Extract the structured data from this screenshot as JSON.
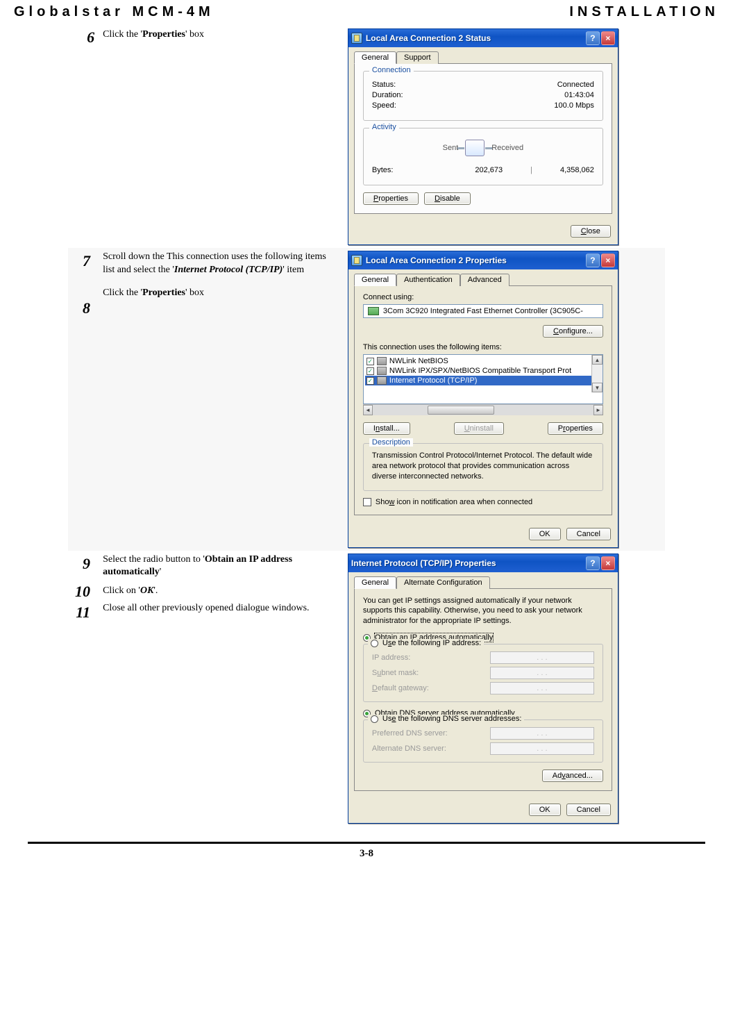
{
  "header": {
    "left": "Globalstar MCM-4M",
    "right": "INSTALLATION"
  },
  "pageNumber": "3-8",
  "steps": {
    "s6": {
      "num": "6",
      "pre": "Click the '",
      "bold": "Properties",
      "post": "' box"
    },
    "s7": {
      "num": "7",
      "pre": "Scroll down the  This connection uses the following items list and select the '",
      "bold": "Internet Protocol (TCP/IP)",
      "post": "' item"
    },
    "s8": {
      "num": "8",
      "pre": "Click the '",
      "bold": "Properties",
      "post": "' box"
    },
    "s9": {
      "num": "9",
      "pre": "Select the radio button to '",
      "bold": "Obtain an IP address automatically",
      "post": "'"
    },
    "s10": {
      "num": "10",
      "pre": "Click on '",
      "bold": "OK",
      "post": "'."
    },
    "s11": {
      "num": "11",
      "text": "Close all other previously opened dialogue windows."
    }
  },
  "win1": {
    "title": "Local Area Connection 2 Status",
    "tabs": {
      "general": "General",
      "support": "Support"
    },
    "groups": {
      "connection": "Connection",
      "activity": "Activity"
    },
    "connection": {
      "statusLabel": "Status:",
      "statusValue": "Connected",
      "durationLabel": "Duration:",
      "durationValue": "01:43:04",
      "speedLabel": "Speed:",
      "speedValue": "100.0 Mbps"
    },
    "activity": {
      "sent": "Sent",
      "received": "Received",
      "bytesLabel": "Bytes:",
      "sentVal": "202,673",
      "recvVal": "4,358,062"
    },
    "buttons": {
      "properties": "Properties",
      "disable": "Disable",
      "close": "Close"
    }
  },
  "win2": {
    "title": "Local Area Connection 2 Properties",
    "tabs": {
      "general": "General",
      "auth": "Authentication",
      "adv": "Advanced"
    },
    "connectUsing": "Connect using:",
    "adapter": "3Com 3C920 Integrated Fast Ethernet Controller (3C905C-",
    "configure": "Configure...",
    "itemsLabel": "This connection uses the following items:",
    "items": {
      "i1": "NWLink NetBIOS",
      "i2": "NWLink IPX/SPX/NetBIOS Compatible Transport Prot",
      "i3": "Internet Protocol (TCP/IP)"
    },
    "buttons": {
      "install": "Install...",
      "uninstall": "Uninstall",
      "properties": "Properties"
    },
    "descTitle": "Description",
    "descText": "Transmission Control Protocol/Internet Protocol. The default wide area network protocol that provides communication across diverse interconnected networks.",
    "showIcon": "Show icon in notification area when connected",
    "ok": "OK",
    "cancel": "Cancel"
  },
  "win3": {
    "title": "Internet Protocol (TCP/IP) Properties",
    "tabs": {
      "general": "General",
      "alt": "Alternate Configuration"
    },
    "intro": "You can get IP settings assigned automatically if your network supports this capability. Otherwise, you need to ask your network administrator for the appropriate IP settings.",
    "r1": "Obtain an IP address automatically",
    "r2": "Use the following IP address:",
    "ip": {
      "addr": "IP address:",
      "mask": "Subnet mask:",
      "gw": "Default gateway:"
    },
    "r3": "Obtain DNS server address automatically",
    "r4": "Use the following DNS server addresses:",
    "dns": {
      "pref": "Preferred DNS server:",
      "alt": "Alternate DNS server:"
    },
    "advanced": "Advanced...",
    "ok": "OK",
    "cancel": "Cancel"
  }
}
